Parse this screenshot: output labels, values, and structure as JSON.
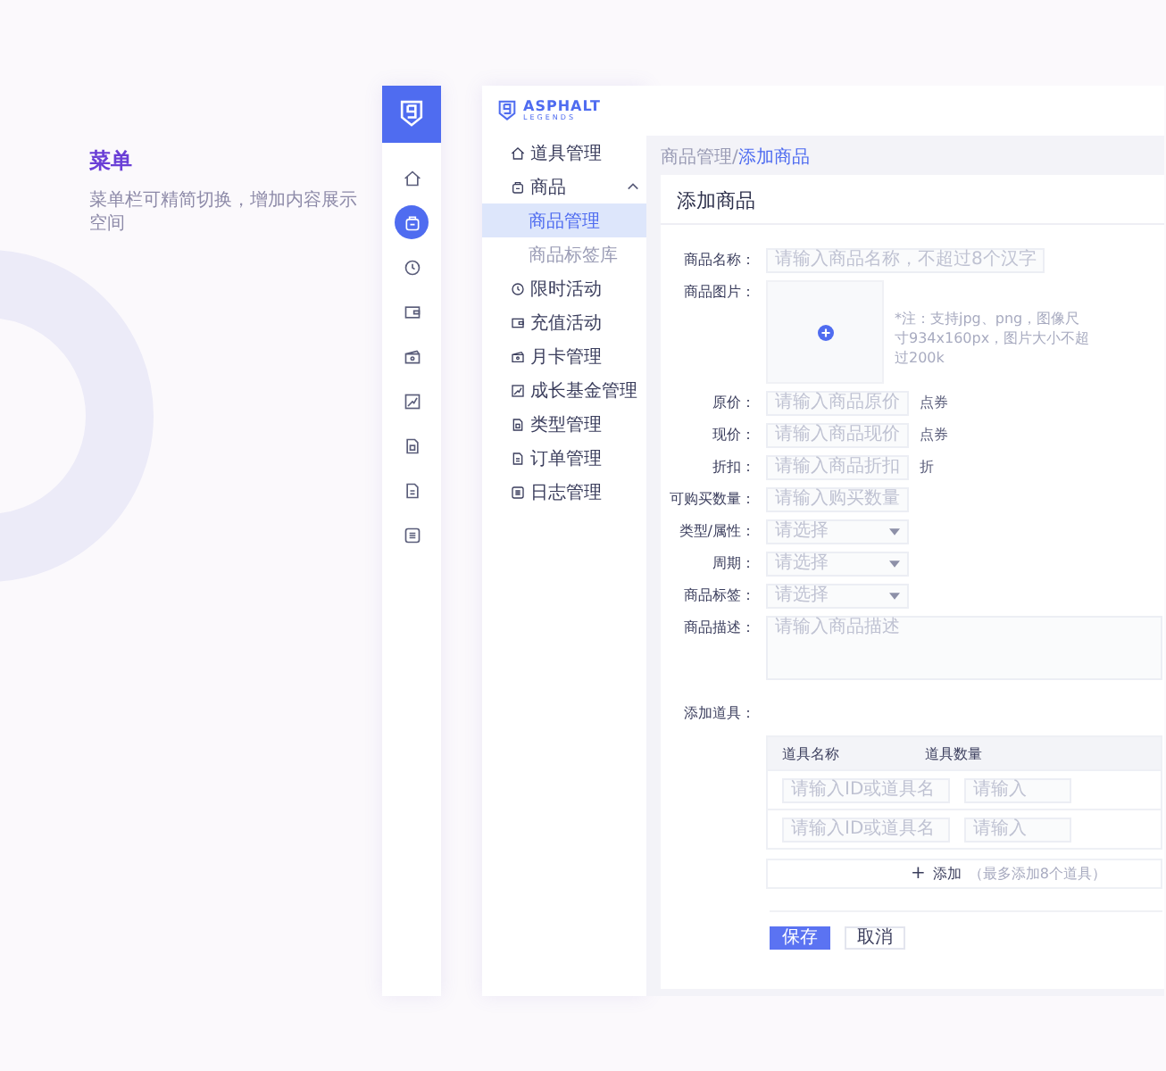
{
  "intro": {
    "title": "菜单",
    "description": "菜单栏可精简切换，增加内容展示空间"
  },
  "brand": {
    "name": "ASPHALT",
    "tagline": "LEGENDS"
  },
  "rail": [
    {
      "selected": false
    },
    {
      "selected": true
    },
    {
      "selected": false
    },
    {
      "selected": false
    },
    {
      "selected": false
    },
    {
      "selected": false
    },
    {
      "selected": false
    },
    {
      "selected": false
    },
    {
      "selected": false
    }
  ],
  "menu": [
    {
      "label": "道具管理"
    },
    {
      "label": "商品",
      "expanded": true,
      "children": [
        {
          "label": "商品管理",
          "selected": true
        },
        {
          "label": "商品标签库",
          "selected": false
        }
      ]
    },
    {
      "label": "限时活动"
    },
    {
      "label": "充值活动"
    },
    {
      "label": "月卡管理"
    },
    {
      "label": "成长基金管理"
    },
    {
      "label": "类型管理"
    },
    {
      "label": "订单管理"
    },
    {
      "label": "日志管理"
    }
  ],
  "breadcrumb": [
    {
      "label": "商品管理/",
      "current": false
    },
    {
      "label": "添加商品",
      "current": true
    }
  ],
  "form": {
    "title": "添加商品",
    "fields": [
      {
        "kind": "long-text",
        "label": "商品名称：",
        "placeholder": "请输入商品名称，不超过8个汉字"
      },
      {
        "kind": "image",
        "label": "商品图片：",
        "hint": "*注：支持jpg、png，图像尺寸934x160px，图片大小不超过200k"
      },
      {
        "kind": "text",
        "label": "原价：",
        "placeholder": "请输入商品原价",
        "unit": "点券"
      },
      {
        "kind": "text",
        "label": "现价：",
        "placeholder": "请输入商品现价",
        "unit": "点券"
      },
      {
        "kind": "text",
        "label": "折扣：",
        "placeholder": "请输入商品折扣",
        "unit": "折"
      },
      {
        "kind": "text",
        "label": "可购买数量：",
        "placeholder": "请输入购买数量"
      },
      {
        "kind": "select",
        "label": "类型/属性：",
        "placeholder": "请选择"
      },
      {
        "kind": "select",
        "label": "周期：",
        "placeholder": "请选择"
      },
      {
        "kind": "select",
        "label": "商品标签：",
        "placeholder": "请选择"
      },
      {
        "kind": "textarea",
        "label": "商品描述：",
        "placeholder": "请输入商品描述"
      }
    ],
    "items": {
      "label": "添加道具：",
      "columns": [
        "道具名称",
        "道具数量"
      ],
      "rows": [
        [
          "请输入ID或道具名",
          "请输入"
        ],
        [
          "请输入ID或道具名",
          "请输入"
        ]
      ],
      "add_icon": "+",
      "add_label": "添加",
      "add_note": "（最多添加8个道具）"
    },
    "buttons": [
      {
        "label": "保存",
        "primary": true
      },
      {
        "label": "取消",
        "primary": false
      }
    ]
  }
}
